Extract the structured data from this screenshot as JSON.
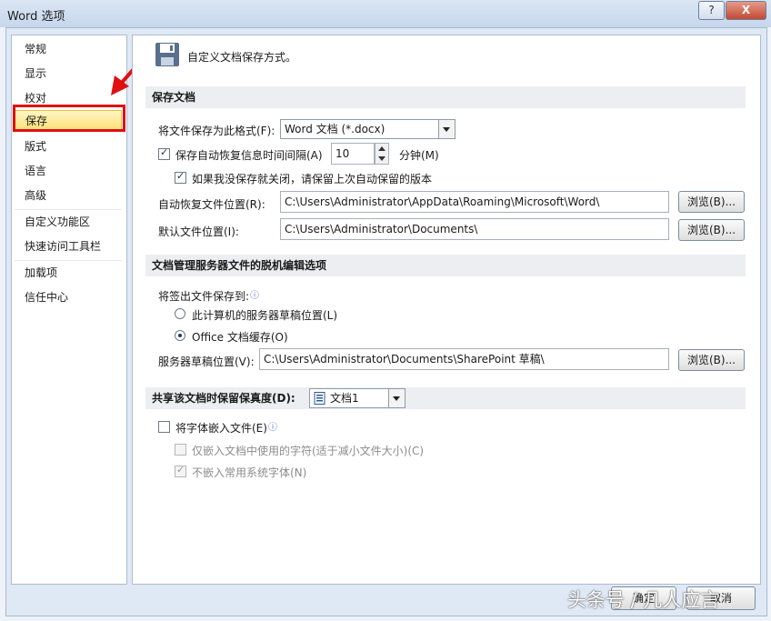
{
  "window": {
    "title": "Word 选项",
    "help_label": "?",
    "close_label": "X"
  },
  "nav": {
    "items": [
      {
        "label": "常规"
      },
      {
        "label": "显示"
      },
      {
        "label": "校对"
      },
      {
        "label": "保存"
      },
      {
        "label": "版式"
      },
      {
        "label": "语言"
      },
      {
        "label": "高级"
      },
      {
        "label": "自定义功能区"
      },
      {
        "label": "快速访问工具栏"
      },
      {
        "label": "加载项"
      },
      {
        "label": "信任中心"
      }
    ],
    "selected": "保存"
  },
  "header": {
    "text": "自定义文档保存方式。"
  },
  "save_docs": {
    "section_title": "保存文档",
    "format_label": "将文件保存为此格式(F):",
    "format_value": "Word 文档 (*.docx)",
    "autorecover_label": "保存自动恢复信息时间间隔(A)",
    "autorecover_checked": true,
    "autorecover_value": "10",
    "minutes_label": "分钟(M)",
    "keep_last_label": "如果我没保存就关闭，请保留上次自动保留的版本",
    "keep_last_checked": true,
    "autorecover_loc_label": "自动恢复文件位置(R):",
    "autorecover_loc_value": "C:\\Users\\Administrator\\AppData\\Roaming\\Microsoft\\Word\\",
    "default_loc_label": "默认文件位置(I):",
    "default_loc_value": "C:\\Users\\Administrator\\Documents\\",
    "browse_label": "浏览(B)..."
  },
  "offline": {
    "section_title": "文档管理服务器文件的脱机编辑选项",
    "checkout_label": "将签出文件保存到:",
    "option_server": "此计算机的服务器草稿位置(L)",
    "option_office": "Office 文档缓存(O)",
    "selected_option": "Office 文档缓存(O)",
    "drafts_loc_label": "服务器草稿位置(V):",
    "drafts_loc_value": "C:\\Users\\Administrator\\Documents\\SharePoint 草稿\\",
    "browse_label": "浏览(B)..."
  },
  "fidelity": {
    "section_title": "共享该文档时保留保真度(D):",
    "document_value": "文档1",
    "embed_fonts_label": "将字体嵌入文件(E)",
    "embed_fonts_checked": false,
    "embed_used_only_label": "仅嵌入文档中使用的字符(适于减小文件大小)(C)",
    "embed_used_only_checked": false,
    "no_common_fonts_label": "不嵌入常用系统字体(N)",
    "no_common_fonts_checked": true
  },
  "footer": {
    "ok_label": "确定",
    "cancel_label": "取消"
  },
  "watermark": {
    "text": "头条号 / 几人应言"
  },
  "icons": {
    "save": "floppy-disk-icon",
    "info": "info-icon",
    "arrow": "red-arrow-annotation",
    "doc": "word-document-icon"
  },
  "colors": {
    "highlight_box": "#e01010",
    "selected_nav": "#fde27b"
  }
}
